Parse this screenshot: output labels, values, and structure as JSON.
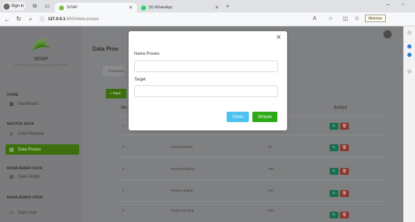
{
  "browser": {
    "profile_label": "Sign in",
    "tabs": [
      {
        "label": "SITAP",
        "active": true
      },
      {
        "label": "(9) WhatsApp",
        "active": false
      }
    ],
    "url_host": "127.0.0.1",
    "url_path": ":8000/data-proses",
    "minimize_tooltip": "Minimize"
  },
  "sidebar": {
    "brand": "SITAP",
    "brand_sub": "SYSTEM INFORMASI TATA KERJA PROSES",
    "sections": {
      "home": "HOME",
      "master": "MASTER DATA",
      "manajemen_data": "MANAJEMEN DATA",
      "manajemen_user": "MANAJEMEN USER"
    },
    "items": {
      "dashboard": "Dashboard",
      "pegawai": "Data Pegawai",
      "proses": "Data Proses",
      "target": "Data Target",
      "user": "Data User"
    }
  },
  "main": {
    "title": "Data Pros",
    "search_placeholder": "Pencarian",
    "input_button": "+ Input",
    "col_no": "No",
    "col_action": "Action",
    "rows": [
      {
        "no": "1",
        "name": "",
        "target": ""
      },
      {
        "no": "2",
        "name": "Edging Diminan",
        "target": "90"
      },
      {
        "no": "3",
        "name": "Radius Polishing",
        "target": "480"
      },
      {
        "no": "4",
        "name": "Radius Lapping",
        "target": "450"
      },
      {
        "no": "5",
        "name": "Radius Grinding",
        "target": "600"
      }
    ]
  },
  "modal": {
    "field1_label": "Nama Proses",
    "field1_value": "",
    "field2_label": "Target",
    "field2_value": "",
    "close_label": "Close",
    "save_label": "Simpan"
  },
  "colors": {
    "accent_green": "#2ea91a",
    "close_blue": "#4cc3ef"
  }
}
